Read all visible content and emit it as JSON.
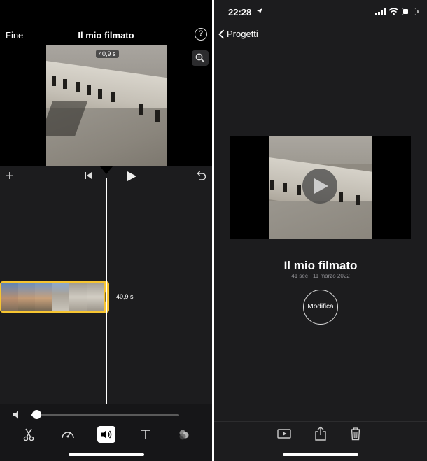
{
  "editor": {
    "done_label": "Fine",
    "title": "Il mio filmato",
    "help_label": "?",
    "preview_duration": "40,9 s",
    "add_label": "+",
    "clip_duration": "40,9 s",
    "volume_level": 0.02,
    "tools": [
      {
        "name": "scissors-icon",
        "active": false
      },
      {
        "name": "speed-icon",
        "active": false
      },
      {
        "name": "volume-icon",
        "active": true
      },
      {
        "name": "text-icon",
        "active": false
      },
      {
        "name": "filters-icon",
        "active": false
      }
    ]
  },
  "project": {
    "status_time": "22:28",
    "back_label": "Progetti",
    "title": "Il mio filmato",
    "meta": "41 sec · 11 marzo 2022",
    "edit_label": "Modifica",
    "battery_level": 0.4,
    "bottom_tools": [
      "play-preview-icon",
      "share-icon",
      "trash-icon"
    ]
  },
  "colors": {
    "clip_border": "#f7c531",
    "panel_dark": "#1c1c1e",
    "divider": "#ffffff"
  }
}
